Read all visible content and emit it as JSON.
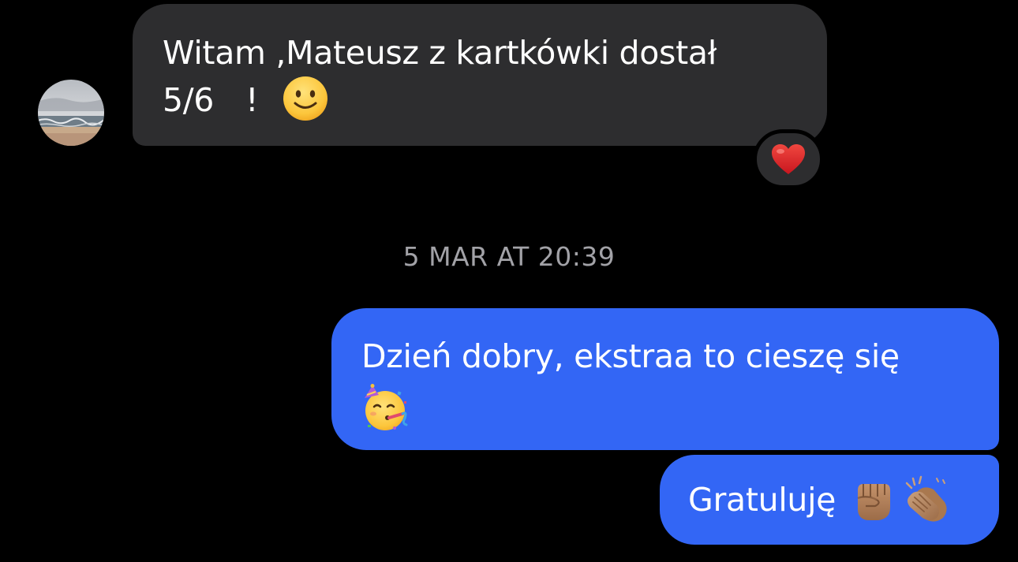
{
  "conversation": {
    "incoming_message": {
      "line1": "Witam ,Mateusz z kartkówki dostał",
      "line2_score": "5/6",
      "line2_exclam": "!",
      "emoji": "slightly-smiling-face-icon",
      "reaction": "red-heart-icon"
    },
    "timestamp": "5 MAR AT 20:39",
    "outgoing_messages": [
      {
        "text": "Dzień dobry, ekstraa to cieszę się",
        "emoji": "partying-face-icon"
      },
      {
        "text": "Gratuluję",
        "emojis": [
          "raised-fist-icon",
          "clapping-hands-icon"
        ]
      }
    ]
  },
  "colors": {
    "background": "#000000",
    "incoming_bubble": "#2d2d2f",
    "outgoing_bubble": "#3366f5",
    "timestamp_text": "#a2a2a7",
    "message_text": "#ffffff"
  }
}
